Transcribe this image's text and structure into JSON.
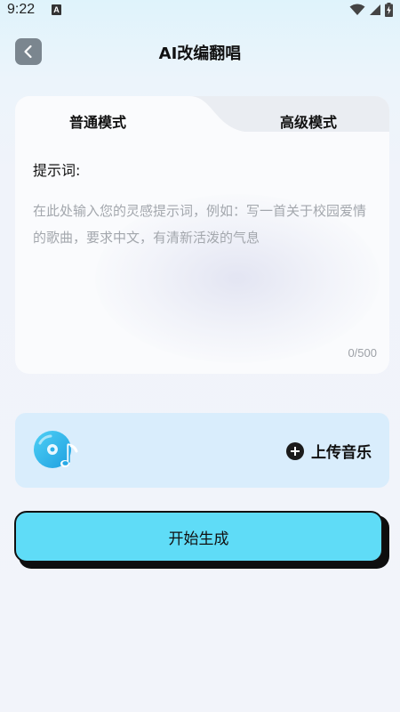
{
  "status_bar": {
    "time": "9:22",
    "notification_letter": "A",
    "icons": [
      "wifi-icon",
      "cellular-signal-icon",
      "battery-charging-icon"
    ]
  },
  "header": {
    "back_icon": "chevron-left-icon",
    "title": "AI改编翻唱"
  },
  "mode_tabs": {
    "items": [
      {
        "label": "普通模式",
        "selected": true
      },
      {
        "label": "高级模式",
        "selected": false
      }
    ]
  },
  "prompt": {
    "label": "提示词:",
    "value": "",
    "placeholder": "在此处输入您的灵感提示词，例如：写一首关于校园爱情的歌曲，要求中文，有清新活泼的气息",
    "char_count": "0/500"
  },
  "upload": {
    "icon": "music-disc-icon",
    "button_icon": "plus-circle-icon",
    "button_label": "上传音乐"
  },
  "generate": {
    "label": "开始生成"
  },
  "colors": {
    "accent": "#5fdcf7",
    "upload_card": "#d9edfc",
    "back_button": "#7b868f"
  }
}
